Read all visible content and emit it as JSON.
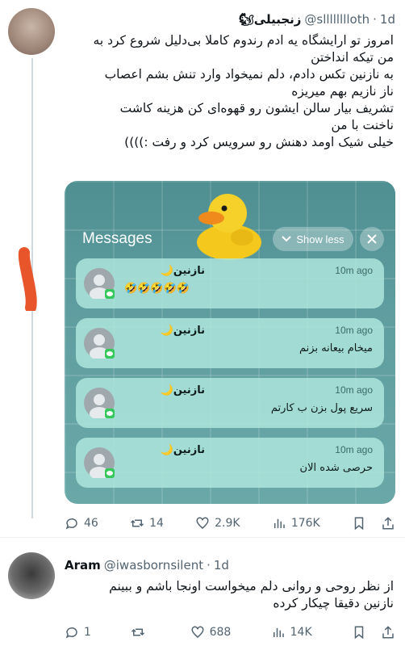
{
  "tweet1": {
    "display_name": "زنجبیلی",
    "name_emoji": "🐿",
    "handle": "@slllllllloth",
    "time": "1d",
    "text_lines": [
      "امروز تو ارایشگاه یه ادم رندوم کاملا بی‌دلیل شروع کرد به",
      "من تیکه انداختن",
      "به نازنین تکس دادم، دلم نمیخواد وارد تنش بشم اعصاب",
      "ناز نازیم بهم میریزه",
      "تشریف بیار سالن ایشون رو قهوه‌ای کن هزینه کاشت",
      "ناخنت با من",
      "خیلی شیک اومد دهنش رو سرویس کرد و رفت :))))"
    ],
    "badge_number": "۱",
    "stats": {
      "replies": "46",
      "reposts": "14",
      "likes": "2.9K",
      "views": "176K"
    }
  },
  "messages_card": {
    "title": "Messages",
    "show_less_label": "Show less",
    "notifications": [
      {
        "sender": "نازنین🌙",
        "time": "10m ago",
        "body": "🤣🤣🤣🤣🤣"
      },
      {
        "sender": "نازنین🌙",
        "time": "10m ago",
        "body": "میخام بیعانه بزنم"
      },
      {
        "sender": "نازنین🌙",
        "time": "10m ago",
        "body": "سریع پول بزن ب کارتم"
      },
      {
        "sender": "نازنین🌙",
        "time": "10m ago",
        "body": "حرصی شده الان"
      }
    ]
  },
  "tweet2": {
    "display_name": "Aram",
    "handle": "@iwasbornsilent",
    "time": "1d",
    "text_lines": [
      "از نظر روحی و روانی دلم میخواست اونجا باشم و ببینم",
      "نازنین دقیقا چیکار کرده"
    ],
    "stats": {
      "replies": "1",
      "reposts": "",
      "likes": "688",
      "views": "14K"
    }
  },
  "colors": {
    "accent_red": "#e8552a",
    "card_teal": "#5f9ea0",
    "notif_bg": "#b0e8de",
    "muted": "#536471"
  },
  "icons": [
    "reply-icon",
    "repost-icon",
    "like-icon",
    "views-icon",
    "bookmark-icon",
    "chevron-down-icon",
    "close-icon",
    "messages-app-icon",
    "duck-image"
  ]
}
